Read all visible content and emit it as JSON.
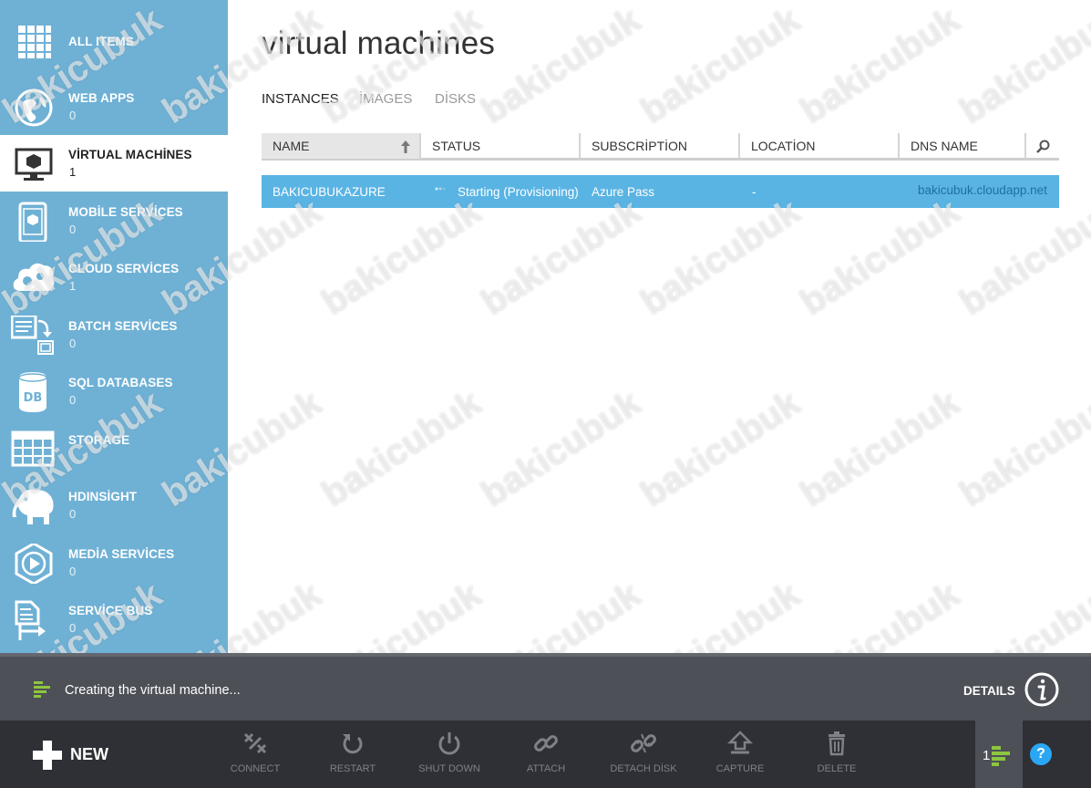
{
  "sidebar": {
    "items": [
      {
        "label": "ALL ITEMS",
        "count": "",
        "icon": "grid-icon"
      },
      {
        "label": "WEB APPS",
        "count": "0",
        "icon": "globe-icon"
      },
      {
        "label": "VİRTUAL MACHİNES",
        "count": "1",
        "icon": "monitor-icon",
        "active": true
      },
      {
        "label": "MOBİLE SERVİCES",
        "count": "0",
        "icon": "phone-icon"
      },
      {
        "label": "CLOUD SERVİCES",
        "count": "1",
        "icon": "cloud-gear-icon"
      },
      {
        "label": "BATCH SERVİCES",
        "count": "0",
        "icon": "batch-icon"
      },
      {
        "label": "SQL DATABASES",
        "count": "0",
        "icon": "database-icon"
      },
      {
        "label": "STORAGE",
        "count": "",
        "icon": "table-icon"
      },
      {
        "label": "HDINSİGHT",
        "count": "0",
        "icon": "elephant-icon"
      },
      {
        "label": "MEDİA SERVİCES",
        "count": "0",
        "icon": "media-play-icon"
      },
      {
        "label": "SERVİCE BUS",
        "count": "0",
        "icon": "service-bus-icon"
      }
    ]
  },
  "main": {
    "title": "virtual machines",
    "tabs": [
      {
        "label": "INSTANCES",
        "active": true
      },
      {
        "label": "İMAGES"
      },
      {
        "label": "DİSKS"
      }
    ],
    "columns": [
      "NAME",
      "STATUS",
      "SUBSCRİPTİON",
      "LOCATİON",
      "DNS NAME"
    ],
    "rows": [
      {
        "name": "BAKICUBUKAZURE",
        "status": "Starting (Provisioning)",
        "subscription": "Azure Pass",
        "location": "-",
        "dns": "bakicubuk.cloudapp.net"
      }
    ]
  },
  "watermark": {
    "text": "bakicubuk"
  },
  "notification": {
    "text": "Creating the virtual machine...",
    "details_label": "DETAILS"
  },
  "commandbar": {
    "new_label": "NEW",
    "commands": [
      {
        "label": "CONNECT",
        "icon": "connect-icon"
      },
      {
        "label": "RESTART",
        "icon": "restart-icon"
      },
      {
        "label": "SHUT DOWN",
        "icon": "power-icon"
      },
      {
        "label": "ATTACH",
        "icon": "link-icon"
      },
      {
        "label": "DETACH DİSK",
        "icon": "unlink-icon"
      },
      {
        "label": "CAPTURE",
        "icon": "capture-icon"
      },
      {
        "label": "DELETE",
        "icon": "trash-icon"
      }
    ],
    "operations_count": "1",
    "help_label": "?"
  },
  "colors": {
    "sidebar": "#6fb1d5",
    "selected_row": "#59b4e3",
    "notification_bar": "#4d5057",
    "command_bar": "#2e3035",
    "progress_accent": "#8dc63f",
    "help": "#2ba6f5",
    "link": "#1d6fa5"
  }
}
